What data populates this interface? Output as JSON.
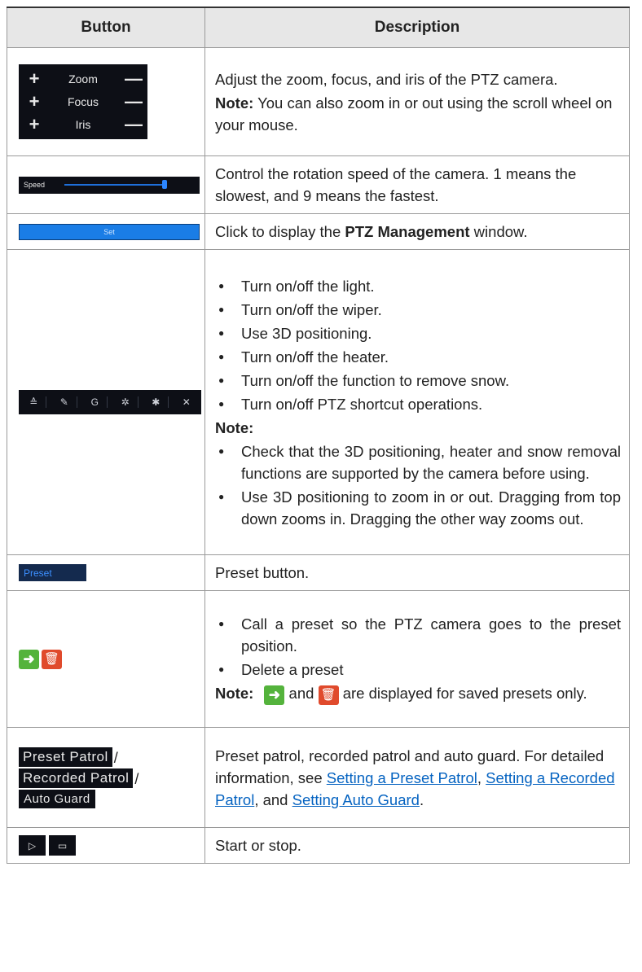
{
  "header": {
    "col1": "Button",
    "col2": "Description"
  },
  "rows": {
    "zfi": {
      "zoom": "Zoom",
      "focus": "Focus",
      "iris": "Iris",
      "plus": "+",
      "minus": "—",
      "desc": "Adjust the zoom, focus, and iris of the PTZ camera.",
      "note_label": "Note:",
      "note_text": " You can also zoom in or out using the scroll wheel on your mouse."
    },
    "speed": {
      "label": "Speed",
      "desc": "Control the rotation speed of the camera. 1 means the slowest, and 9 means the fastest."
    },
    "set": {
      "label": "Set",
      "desc_a": "Click to display the ",
      "desc_bold": "PTZ Management",
      "desc_b": " window."
    },
    "tools": {
      "icons": [
        "≙",
        "✎",
        "G",
        "✲",
        "✱",
        "✕"
      ],
      "bullets": [
        "Turn on/off the light.",
        "Turn on/off the wiper.",
        "Use 3D positioning.",
        "Turn on/off the heater.",
        "Turn on/off the function to remove snow.",
        "Turn on/off PTZ shortcut operations."
      ],
      "note_label": "Note:",
      "notes": [
        "Check that the 3D positioning, heater and snow removal functions are supported by the camera before using.",
        "Use 3D positioning to zoom in or out. Dragging from top down zooms in. Dragging the other way zooms out."
      ]
    },
    "preset": {
      "label": "Preset",
      "desc": "Preset button."
    },
    "callDelete": {
      "go_glyph": "➜",
      "del_glyph": "🗑",
      "bullets": [
        "Call a preset so the PTZ camera goes to the preset position.",
        "Delete a preset"
      ],
      "note_label": "Note:",
      "note_and": " and ",
      "note_rest": " are displayed for saved presets only."
    },
    "patrol": {
      "btn1": "Preset Patrol",
      "btn2": "Recorded Patrol",
      "btn3": "Auto Guard",
      "sep": "/",
      "desc": "Preset patrol, recorded patrol and auto guard. For detailed information, see ",
      "link1": "Setting a Preset Patrol",
      "comma1": ", ",
      "link2": "Setting a Recorded Patrol",
      "and": ", and ",
      "link3": "Setting Auto Guard",
      "end": "."
    },
    "startstop": {
      "play": "▷",
      "stop": "▭",
      "desc": "Start or stop."
    }
  }
}
